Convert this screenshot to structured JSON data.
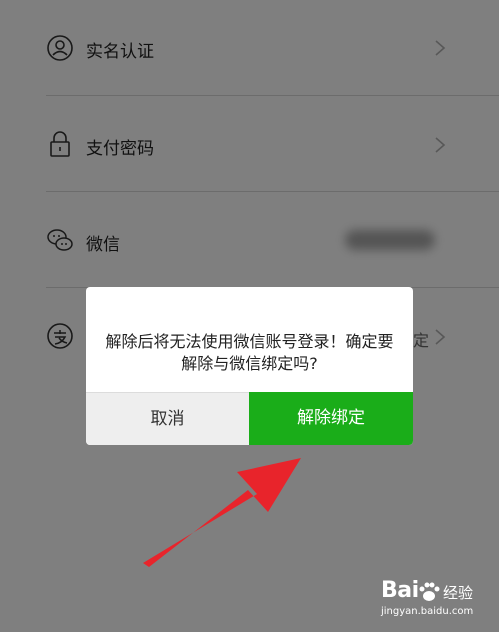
{
  "settings": {
    "items": [
      {
        "label": "实名认证",
        "icon": "id-card-icon"
      },
      {
        "label": "支付密码",
        "icon": "lock-icon"
      },
      {
        "label": "微信",
        "icon": "wechat-icon"
      },
      {
        "label": "",
        "value": "定",
        "icon": "alipay-icon"
      }
    ]
  },
  "dialog": {
    "message": "解除后将无法使用微信账号登录！确定要解除与微信绑定吗?",
    "cancel_label": "取消",
    "confirm_label": "解除绑定"
  },
  "watermark": {
    "brand": "Bai",
    "brand_suffix": "经验",
    "url": "jingyan.baidu.com"
  },
  "colors": {
    "confirm": "#1aad19",
    "cancel_bg": "#eeeeee",
    "arrow": "#e8242b"
  }
}
